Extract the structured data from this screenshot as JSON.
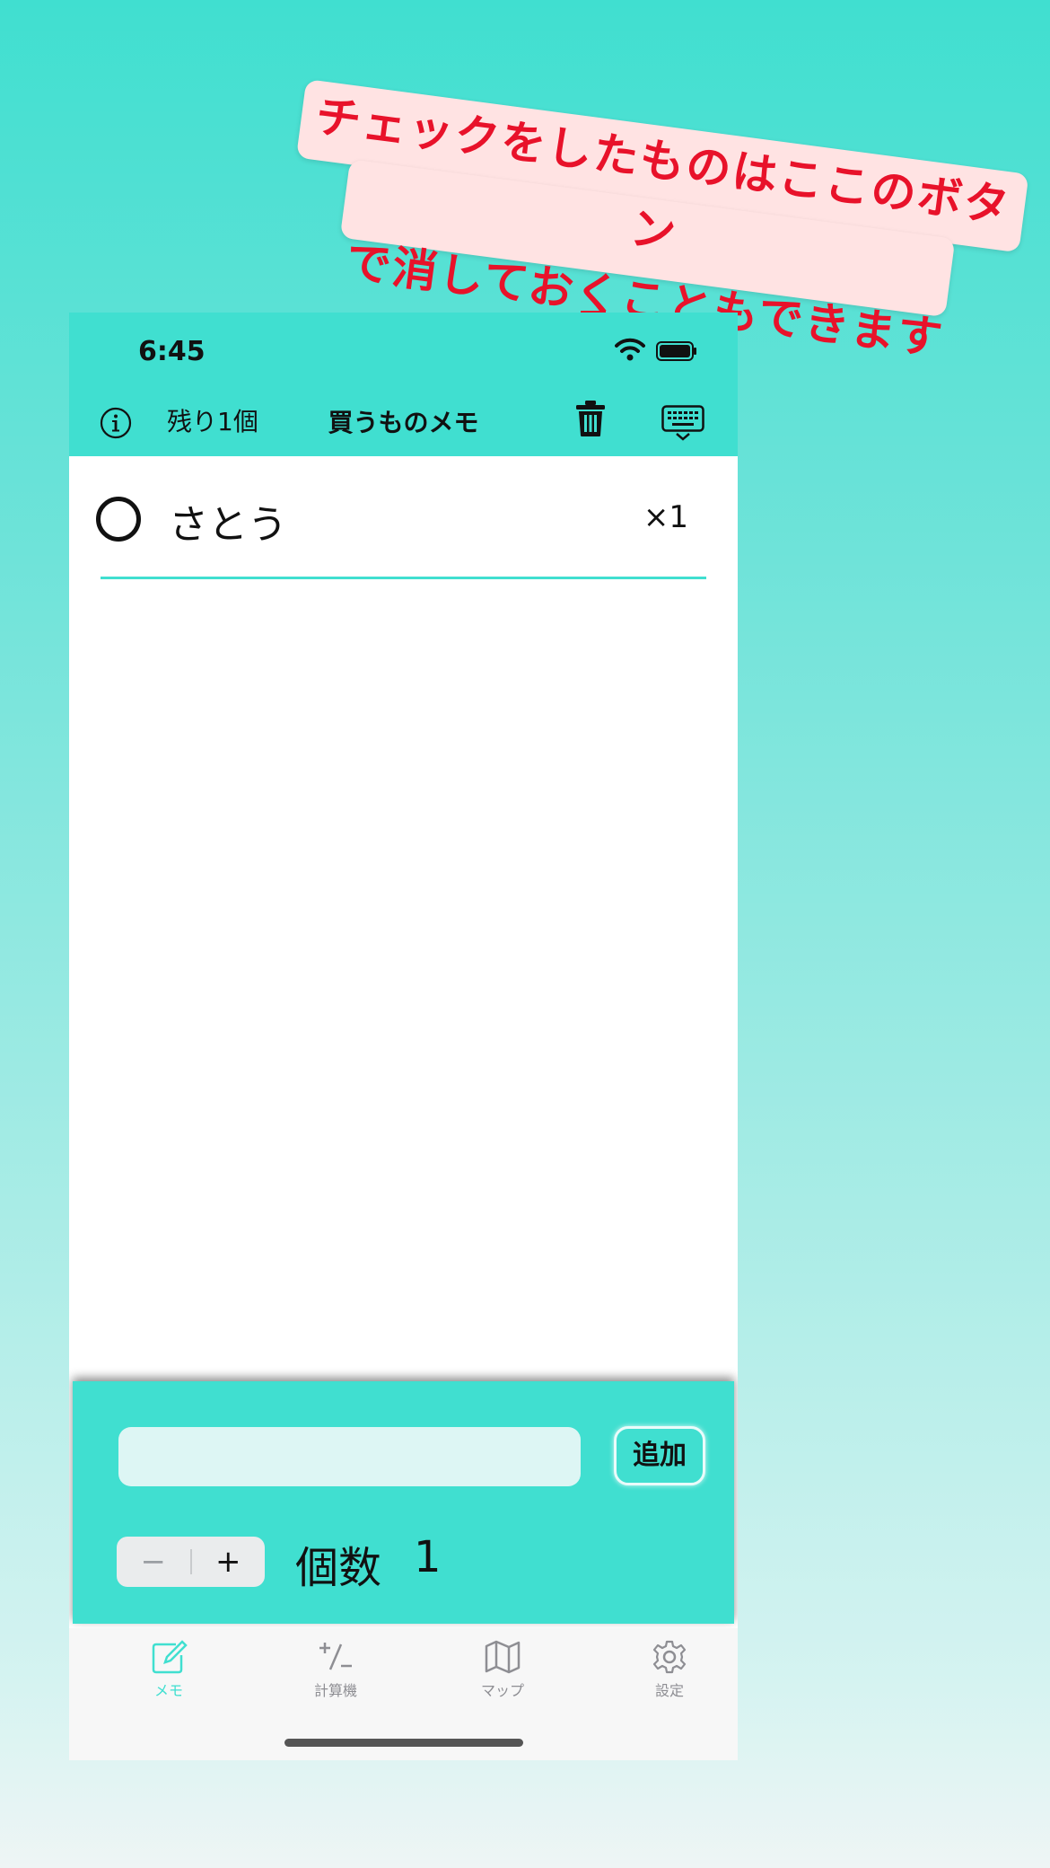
{
  "callout": {
    "line1": "チェックをしたものはここのボタン",
    "line2": "で消しておくこともできます",
    "color": "#e8122a"
  },
  "status_bar": {
    "time": "6:45"
  },
  "header": {
    "remaining": "残り1個",
    "title": "買うものメモ",
    "bg_color": "#40dfd0"
  },
  "items": [
    {
      "name": "さとう",
      "quantity": "×1",
      "checked": false
    }
  ],
  "input": {
    "placeholder": "",
    "add_label": "追加",
    "count_label": "個数",
    "count_value": "1",
    "minus": "−",
    "plus": "+"
  },
  "tabs": [
    {
      "label": "メモ",
      "icon": "memo-edit-icon",
      "active": true
    },
    {
      "label": "計算機",
      "icon": "plus-minus-icon",
      "active": false
    },
    {
      "label": "マップ",
      "icon": "map-icon",
      "active": false
    },
    {
      "label": "設定",
      "icon": "gear-icon",
      "active": false
    }
  ]
}
